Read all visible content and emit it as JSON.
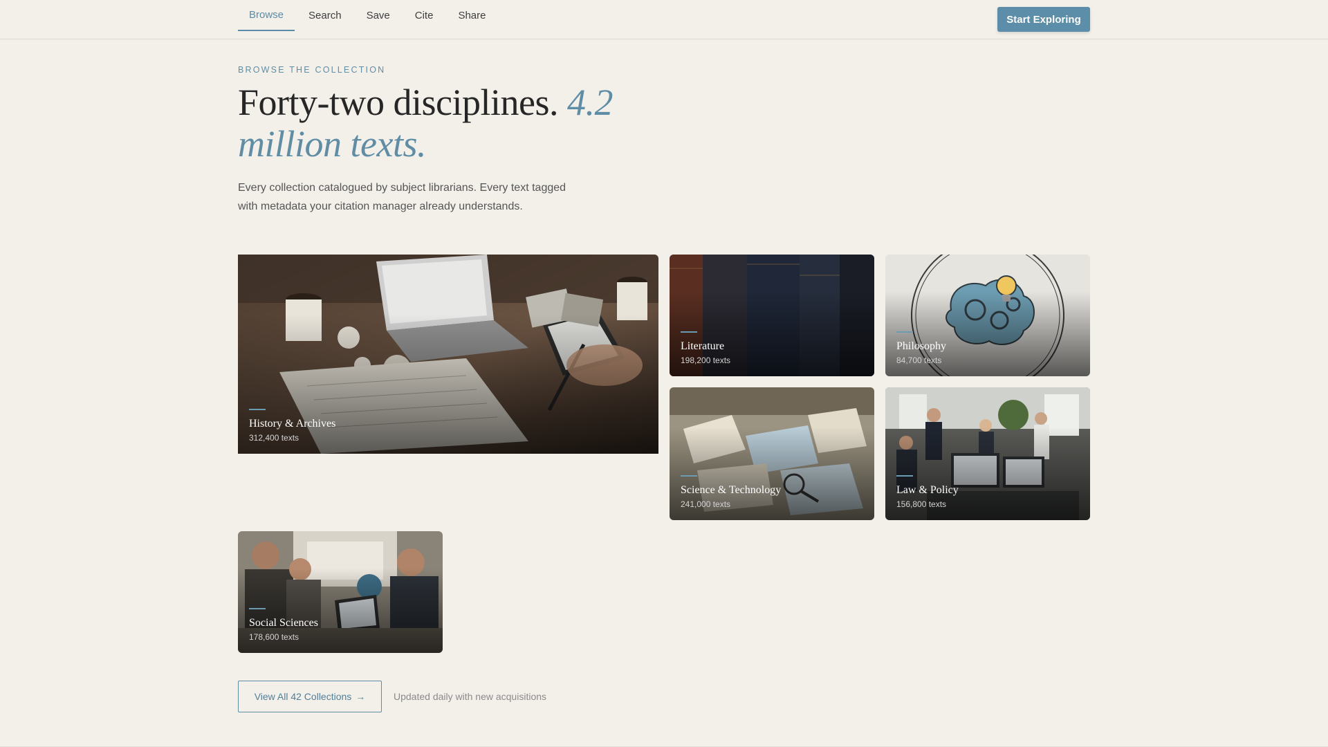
{
  "nav": {
    "tabs": [
      {
        "label": "Browse",
        "active": true
      },
      {
        "label": "Search",
        "active": false
      },
      {
        "label": "Save",
        "active": false
      },
      {
        "label": "Cite",
        "active": false
      },
      {
        "label": "Share",
        "active": false
      }
    ],
    "cta_label": "Start Exploring"
  },
  "hero": {
    "eyebrow": "BROWSE THE COLLECTION",
    "headline_main": "Forty-two disciplines.",
    "headline_accent": "4.2 million texts.",
    "lede": "Every collection catalogued by subject librarians. Every text tagged with metadata your citation manager already understands."
  },
  "collections": [
    {
      "name": "History & Archives",
      "count": "312,400 texts",
      "icon": "desk-photo"
    },
    {
      "name": "Literature",
      "count": "198,200 texts",
      "icon": "book-spines-photo"
    },
    {
      "name": "Philosophy",
      "count": "84,700 texts",
      "icon": "brain-gears-illustration"
    },
    {
      "name": "Science & Technology",
      "count": "241,000 texts",
      "icon": "open-books-map-photo"
    },
    {
      "name": "Law & Policy",
      "count": "156,800 texts",
      "icon": "office-meeting-photo"
    },
    {
      "name": "Social Sciences",
      "count": "178,600 texts",
      "icon": "students-globe-photo"
    }
  ],
  "footer": {
    "view_all_label": "View All 42 Collections",
    "view_all_arrow": "→",
    "updated_note": "Updated daily with new acquisitions"
  },
  "colors": {
    "accent": "#5f8da6",
    "background": "#f3f0ea",
    "cta": "#5c8ea9"
  }
}
